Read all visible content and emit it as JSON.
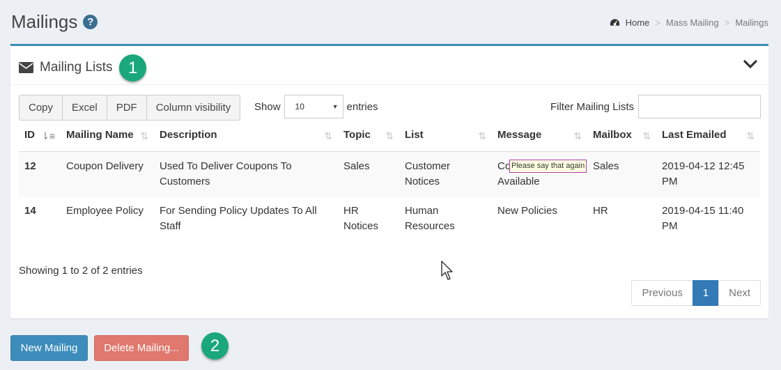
{
  "header": {
    "title": "Mailings",
    "help_icon": "?",
    "breadcrumb": [
      "Home",
      "Mass Mailing",
      "Mailings"
    ]
  },
  "box": {
    "title": "Mailing Lists",
    "step1": "1",
    "buttons": [
      "Copy",
      "Excel",
      "PDF",
      "Column visibility"
    ],
    "length": {
      "show": "Show",
      "value": "10",
      "entries": "entries"
    },
    "filter_label": "Filter Mailing Lists",
    "columns": [
      "ID",
      "Mailing Name",
      "Description",
      "Topic",
      "List",
      "Message",
      "Mailbox",
      "Last Emailed"
    ],
    "rows": [
      [
        "12",
        "Coupon Delivery",
        "Used To Deliver Coupons To Customers",
        "Sales",
        "Customer Notices",
        "Coupons Available",
        "Sales",
        "2019-04-12 12:45 PM"
      ],
      [
        "14",
        "Employee Policy",
        "For Sending Policy Updates To All Staff",
        "HR Notices",
        "Human Resources",
        "New Policies",
        "HR",
        "2019-04-15 11:40 PM"
      ]
    ],
    "row1_message_visible": "Co",
    "row1_message_line2": "Available",
    "tooltip": "Please say that again",
    "info": "Showing 1 to 2 of 2 entries",
    "pagination": {
      "previous": "Previous",
      "current": "1",
      "next": "Next"
    }
  },
  "actions": {
    "new_mailing": "New Mailing",
    "delete_mailing": "Delete Mailing...",
    "step2": "2"
  },
  "colors": {
    "accent": "#3c8dbc",
    "danger": "#e0786e",
    "badge": "#1aa87a",
    "page_bg": "#ecf0f5"
  }
}
